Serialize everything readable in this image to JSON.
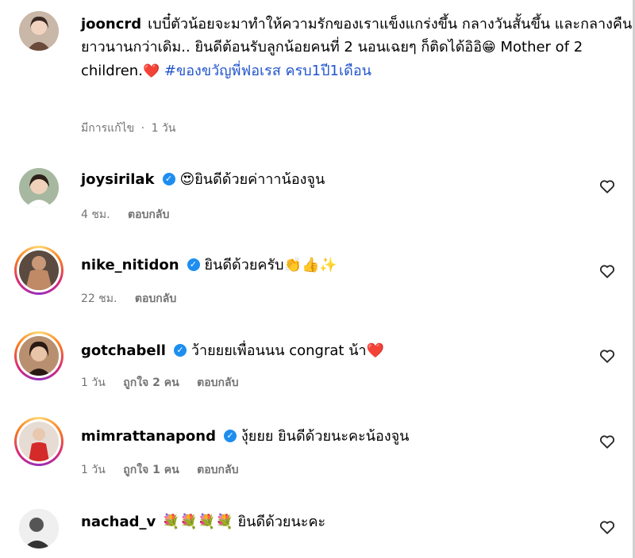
{
  "caption": {
    "username": "jooncrd",
    "text_1": "เบบี๋ตัวน้อยจะมาทำให้ความรักของเราแข็งแกร่งขึ้น กลางวันสั้นขึ้น และกลางคืนยาวนานกว่าเดิม.. ยินดีต้อนรับลูกน้อยคนที่ 2 นอนเฉยๆ ก็ติดได้อิอิ",
    "emoji_1": "😁",
    "text_2": " Mother of 2 children.",
    "emoji_2": "❤️",
    "hashtag": "#ของขวัญพี่ฟอเรส ครบ1ปี1เดือน",
    "edited": "มีการแก้ไข",
    "dot": "·",
    "time": "1 วัน"
  },
  "comments": [
    {
      "username": "joysirilak",
      "verified": true,
      "text": "😍ยินดีด้วยค่าาาน้องจูน",
      "time": "4 ชม.",
      "likes": "",
      "reply": "ตอบกลับ"
    },
    {
      "username": "nike_nitidon",
      "verified": true,
      "text": "ยินดีด้วยครับ👏👍✨",
      "time": "22 ชม.",
      "likes": "",
      "reply": "ตอบกลับ"
    },
    {
      "username": "gotchabell",
      "verified": true,
      "text": "ว้ายยยเพื่อนนน congrat น้า❤️",
      "time": "1 วัน",
      "likes": "ถูกใจ 2 คน",
      "reply": "ตอบกลับ"
    },
    {
      "username": "mimrattanapond",
      "verified": true,
      "text": "งุ้ยยย ยินดีด้วยนะคะน้องจูน",
      "time": "1 วัน",
      "likes": "ถูกใจ 1 คน",
      "reply": "ตอบกลับ"
    },
    {
      "username": "nachad_v",
      "verified": false,
      "text": "💐💐💐💐 ยินดีด้วยนะคะ",
      "time": "",
      "likes": "",
      "reply": ""
    }
  ],
  "icons": {
    "like": "heart-outline-icon",
    "verified": "verified-badge-icon"
  },
  "colors": {
    "hashtag": "#2255cc",
    "verified": "#1d8ef0",
    "meta": "#737373"
  }
}
